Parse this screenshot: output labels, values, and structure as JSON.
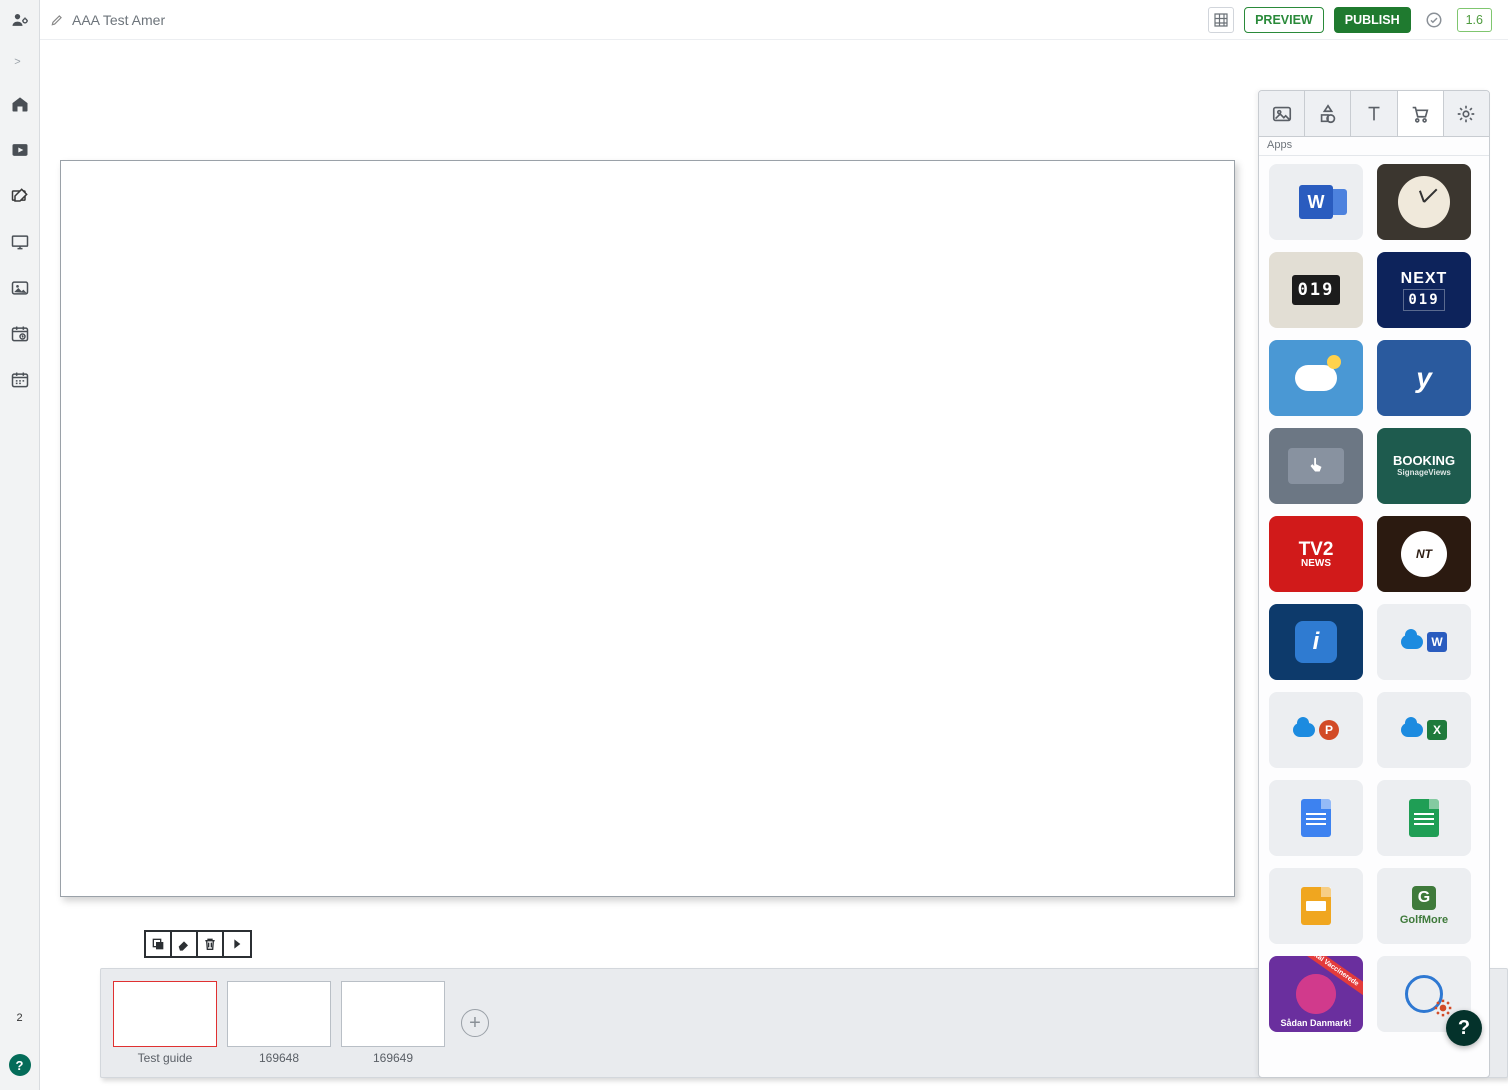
{
  "header": {
    "title": "AAA Test Amer",
    "preview_label": "PREVIEW",
    "publish_label": "PUBLISH",
    "version": "1.6"
  },
  "left_rail": {
    "badge_count": "2"
  },
  "thumbs": {
    "items": [
      {
        "caption": "Test guide",
        "selected": true
      },
      {
        "caption": "169648",
        "selected": false
      },
      {
        "caption": "169649",
        "selected": false
      }
    ]
  },
  "side_panel": {
    "section_label": "Apps",
    "tiles": {
      "counter_digits": "019",
      "next_label": "NEXT",
      "next_digits": "019",
      "yammer_glyph": "y",
      "booking_l1": "BOOKING",
      "booking_l2": "SignageViews",
      "tv2_l1": "TV2",
      "tv2_l2": "NEWS",
      "nt_label": "NT",
      "info_glyph": "i",
      "word_badge": "W",
      "ppt_badge": "P",
      "excel_badge": "X",
      "golf_g": "G",
      "golf_label": "GolfMore",
      "covid_banner": "Antal Vaccinerede",
      "covid_caption": "Sådan Danmark!",
      "word_glyph": "W"
    }
  },
  "help_glyph": "?"
}
